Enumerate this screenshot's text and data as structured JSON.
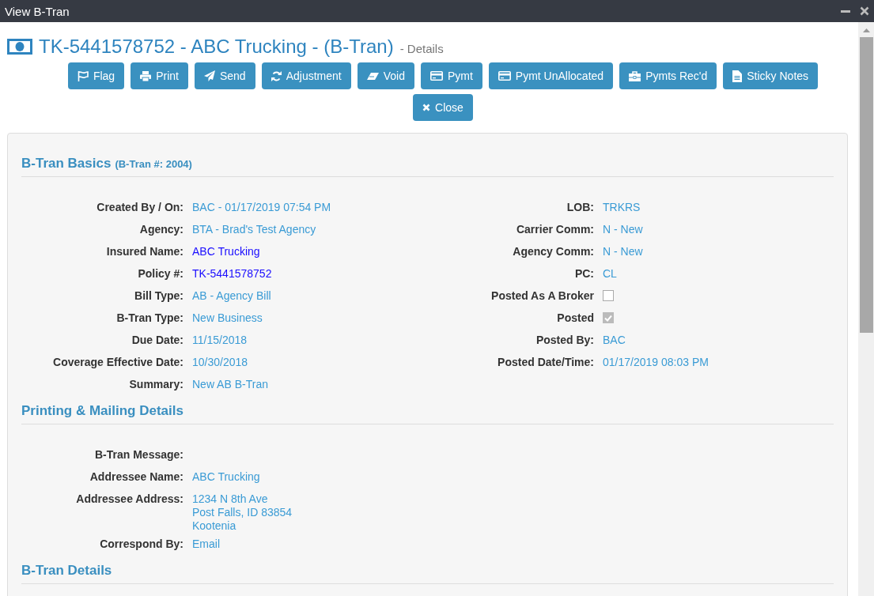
{
  "window": {
    "title": "View B-Tran"
  },
  "heading": {
    "title": "TK-5441578752 - ABC Trucking - (B-Tran)",
    "suffix": "- Details"
  },
  "toolbar": [
    {
      "label": "Flag",
      "kind": "flag"
    },
    {
      "label": "Print",
      "kind": "print"
    },
    {
      "label": "Send",
      "kind": "send"
    },
    {
      "label": "Adjustment",
      "kind": "refresh"
    },
    {
      "label": "Void",
      "kind": "eraser"
    },
    {
      "label": "Pymt",
      "kind": "card"
    },
    {
      "label": "Pymt UnAllocated",
      "kind": "card"
    },
    {
      "label": "Pymts Rec'd",
      "kind": "briefcase"
    },
    {
      "label": "Sticky Notes",
      "kind": "file"
    },
    {
      "label": "Close",
      "kind": "close"
    }
  ],
  "sections": [
    {
      "title": "B-Tran Basics",
      "subtitle": "(B-Tran #: 2004)",
      "columns": [
        [
          {
            "label": "Created By / On:",
            "kind": "text",
            "value": "BAC - 01/17/2019 07:54 PM"
          },
          {
            "label": "Agency:",
            "kind": "text",
            "value": "BTA - Brad's Test Agency"
          },
          {
            "label": "Insured Name:",
            "kind": "link",
            "value": "ABC Trucking"
          },
          {
            "label": "Policy #:",
            "kind": "link",
            "value": "TK-5441578752"
          },
          {
            "label": "Bill Type:",
            "kind": "text",
            "value": "AB - Agency Bill"
          },
          {
            "label": "B-Tran Type:",
            "kind": "text",
            "value": "New Business"
          },
          {
            "label": "Due Date:",
            "kind": "text",
            "value": "11/15/2018"
          },
          {
            "label": "Coverage Effective Date:",
            "kind": "text",
            "value": "10/30/2018"
          },
          {
            "label": "Summary:",
            "kind": "text",
            "value": "New AB B-Tran"
          }
        ],
        [
          {
            "label": "LOB:",
            "kind": "text",
            "value": "TRKRS"
          },
          {
            "label": "Carrier Comm:",
            "kind": "text",
            "value": "N - New"
          },
          {
            "label": "Agency Comm:",
            "kind": "text",
            "value": "N - New"
          },
          {
            "label": "PC:",
            "kind": "text",
            "value": "CL"
          },
          {
            "label": "Posted As A Broker",
            "kind": "checkbox",
            "checked": false
          },
          {
            "label": "Posted",
            "kind": "checkbox",
            "checked": true
          },
          {
            "label": "Posted By:",
            "kind": "text",
            "value": "BAC"
          },
          {
            "label": "Posted Date/Time:",
            "kind": "text",
            "value": "01/17/2019 08:03 PM"
          }
        ]
      ]
    },
    {
      "title": "Printing & Mailing Details",
      "columns": [
        [
          {
            "label": "B-Tran Message:",
            "kind": "text"
          },
          {
            "label": "Addressee Name:",
            "kind": "text",
            "value": "ABC Trucking"
          },
          {
            "label": "Addressee Address:",
            "kind": "lines",
            "lines": [
              "1234 N 8th Ave",
              "Post Falls, ID 83854",
              "Kootenia"
            ]
          },
          {
            "label": "Correspond By:",
            "kind": "text",
            "value": "Email"
          }
        ]
      ]
    },
    {
      "title": "B-Tran Details"
    }
  ]
}
